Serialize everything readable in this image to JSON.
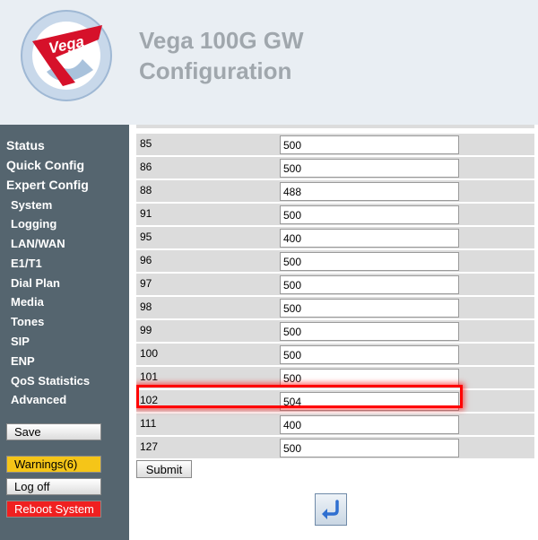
{
  "header": {
    "logo_text": "Vega",
    "title_line1": "Vega 100G GW",
    "title_line2": "Configuration"
  },
  "sidebar": {
    "main_items": [
      "Status",
      "Quick Config",
      "Expert Config"
    ],
    "sub_items": [
      "System",
      "Logging",
      "LAN/WAN",
      "E1/T1",
      "Dial Plan",
      "Media",
      "Tones",
      "SIP",
      "ENP",
      "QoS Statistics",
      "Advanced"
    ],
    "save_label": "Save",
    "warnings_label": "Warnings(6)",
    "logoff_label": "Log off",
    "reboot_label": "Reboot System"
  },
  "table": {
    "rows": [
      {
        "label": "85",
        "value": "500"
      },
      {
        "label": "86",
        "value": "500"
      },
      {
        "label": "88",
        "value": "488"
      },
      {
        "label": "91",
        "value": "500"
      },
      {
        "label": "95",
        "value": "400"
      },
      {
        "label": "96",
        "value": "500"
      },
      {
        "label": "97",
        "value": "500"
      },
      {
        "label": "98",
        "value": "500"
      },
      {
        "label": "99",
        "value": "500"
      },
      {
        "label": "100",
        "value": "500"
      },
      {
        "label": "101",
        "value": "500"
      },
      {
        "label": "102",
        "value": "504"
      },
      {
        "label": "111",
        "value": "400"
      },
      {
        "label": "127",
        "value": "500"
      }
    ]
  },
  "submit_label": "Submit",
  "colors": {
    "sidebar_bg": "#55656f",
    "header_bg": "#e9eef3",
    "highlight": "#ff0000",
    "warning": "#f5c518",
    "reboot": "#f02020"
  },
  "icons": {
    "back": "back-arrow-icon"
  }
}
